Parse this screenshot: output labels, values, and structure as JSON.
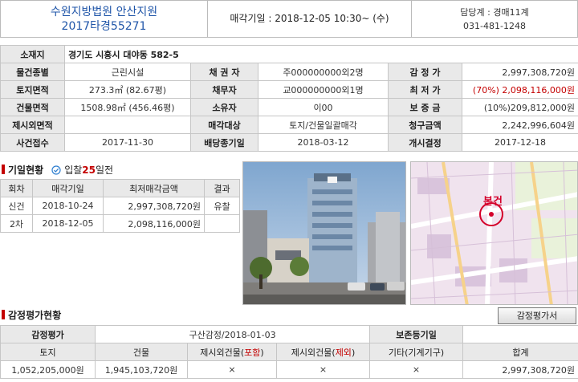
{
  "header": {
    "court_name": "수원지방법원 안산지원",
    "case_no": "2017타경55271",
    "auction_date_label": "매각기일 : 2018-12-05 10:30~ (수)",
    "dept": "담당계 : 경매11계",
    "phone": "031-481-1248"
  },
  "info": {
    "address_label": "소재지",
    "address": "경기도 시흥시 대야동 582-5",
    "row1": [
      "물건종별",
      "근린시설",
      "채 권 자",
      "주000000000외2명",
      "감 정 가",
      "2,997,308,720원"
    ],
    "row2": [
      "토지면적",
      "273.3㎡ (82.67평)",
      "채무자",
      "교000000000외1명",
      "최 저 가",
      "(70%) 2,098,116,000원"
    ],
    "row3": [
      "건물면적",
      "1508.98㎡ (456.46평)",
      "소유자",
      "이00",
      "보 증 금",
      "(10%)209,812,000원"
    ],
    "row4": [
      "제시외면적",
      "",
      "매각대상",
      "토지/건물일괄매각",
      "청구금액",
      "2,242,996,604원"
    ],
    "row5": [
      "사건접수",
      "2017-11-30",
      "배당종기일",
      "2018-03-12",
      "개시결정",
      "2017-12-18"
    ]
  },
  "history": {
    "title": "기일현황",
    "badge_prefix": "입찰",
    "badge_days": "25",
    "badge_suffix": "일전",
    "headers": [
      "회차",
      "매각기일",
      "최저매각금액",
      "결과"
    ],
    "rows": [
      [
        "신건",
        "2018-10-24",
        "2,997,308,720원",
        "유찰"
      ],
      [
        "2차",
        "2018-12-05",
        "2,098,116,000원",
        ""
      ]
    ]
  },
  "map": {
    "marker_label": "본건"
  },
  "appraisal": {
    "title": "감정평가현황",
    "button_label": "감정평가서",
    "row1": [
      "감정평가",
      "구산감정/2018-01-03",
      "보존등기일",
      ""
    ],
    "headers": [
      "토지",
      "건물",
      "제시외건물(",
      "포함",
      ")",
      "제시외건물(",
      "제외",
      ")",
      "기타(기계기구)",
      "합계"
    ],
    "values": [
      "1,052,205,000원",
      "1,945,103,720원",
      "×",
      "×",
      "×",
      "2,997,308,720원"
    ]
  },
  "colors": {
    "accent": "#c40000",
    "title_blue": "#1f55a8",
    "label_bg": "#e9e9e9"
  }
}
